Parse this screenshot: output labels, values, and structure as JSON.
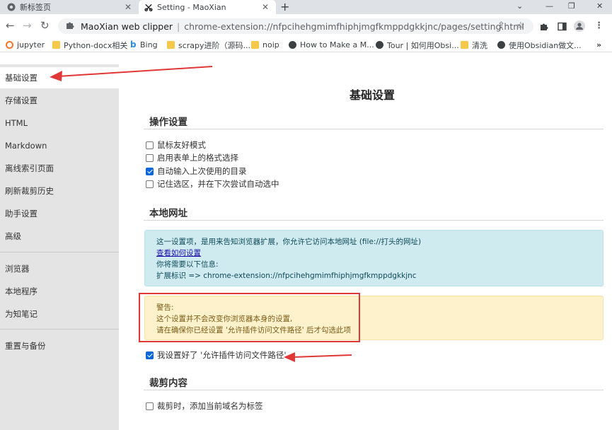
{
  "browser": {
    "tabs": [
      {
        "title": "新标签页",
        "active": false
      },
      {
        "title": "Setting - MaoXian",
        "active": true
      }
    ],
    "omnibox": {
      "site": "MaoXian web clipper",
      "separator": "|",
      "url": "chrome-extension://nfpcihehgmimfhiphjmgfkmppdgkkjnc/pages/setting.html"
    },
    "bookmarks": [
      {
        "label": "jupyter",
        "icon": "jupyter-icon"
      },
      {
        "label": "Python-docx相关",
        "icon": "folder-icon"
      },
      {
        "label": "Bing",
        "icon": "bing-icon"
      },
      {
        "label": "scrapy进阶（源码...",
        "icon": "folder-icon"
      },
      {
        "label": "noip",
        "icon": "folder-icon"
      },
      {
        "label": "How to Make a M...",
        "icon": "globe-icon"
      },
      {
        "label": "Tour | 如何用Obsi...",
        "icon": "globe-icon"
      },
      {
        "label": "清洗",
        "icon": "folder-icon"
      },
      {
        "label": "使用Obsidian做文...",
        "icon": "globe-icon"
      }
    ]
  },
  "sidebar": {
    "groups": [
      [
        "基础设置",
        "存储设置",
        "HTML",
        "Markdown",
        "离线索引页面",
        "刷新裁剪历史",
        "助手设置",
        "高级"
      ],
      [
        "浏览器",
        "本地程序",
        "为知笔记"
      ],
      [
        "重置与备份"
      ]
    ],
    "active": "基础设置"
  },
  "main": {
    "page_title": "基础设置",
    "sections": {
      "operation": {
        "title": "操作设置",
        "options": [
          {
            "label": "鼠标友好模式",
            "checked": false
          },
          {
            "label": "启用表单上的格式选择",
            "checked": false
          },
          {
            "label": "自动输入上次使用的目录",
            "checked": true
          },
          {
            "label": "记住选区，并在下次尝试自动选中",
            "checked": false
          }
        ]
      },
      "local_url": {
        "title": "本地网址",
        "info": {
          "line1": "这一设置项，是用来告知浏览器扩展，你允许它访问本地网址 (file://打头的网址)",
          "link": "查看如何设置",
          "line3": "你将需要以下信息:",
          "line4": "扩展标识 => chrome-extension://nfpcihehgmimfhiphjmgfkmppdgkkjnc"
        },
        "warning": {
          "title": "警告:",
          "line1": "这个设置并不会改变你浏览器本身的设置,",
          "line2": "请在确保你已经设置 '允许插件访问文件路径' 后才勾选此项"
        },
        "confirm": {
          "label": "我设置好了 '允许插件访问文件路径'",
          "checked": true
        }
      },
      "clipping": {
        "title": "裁剪内容",
        "options": [
          {
            "label": "裁剪时，添加当前域名为标签",
            "checked": false
          }
        ]
      }
    }
  },
  "colors": {
    "annotation_red": "#e03737",
    "info_bg": "#d0ebf0",
    "warning_bg": "#fdf2cc",
    "sidebar_bg": "#e4e4e4"
  }
}
